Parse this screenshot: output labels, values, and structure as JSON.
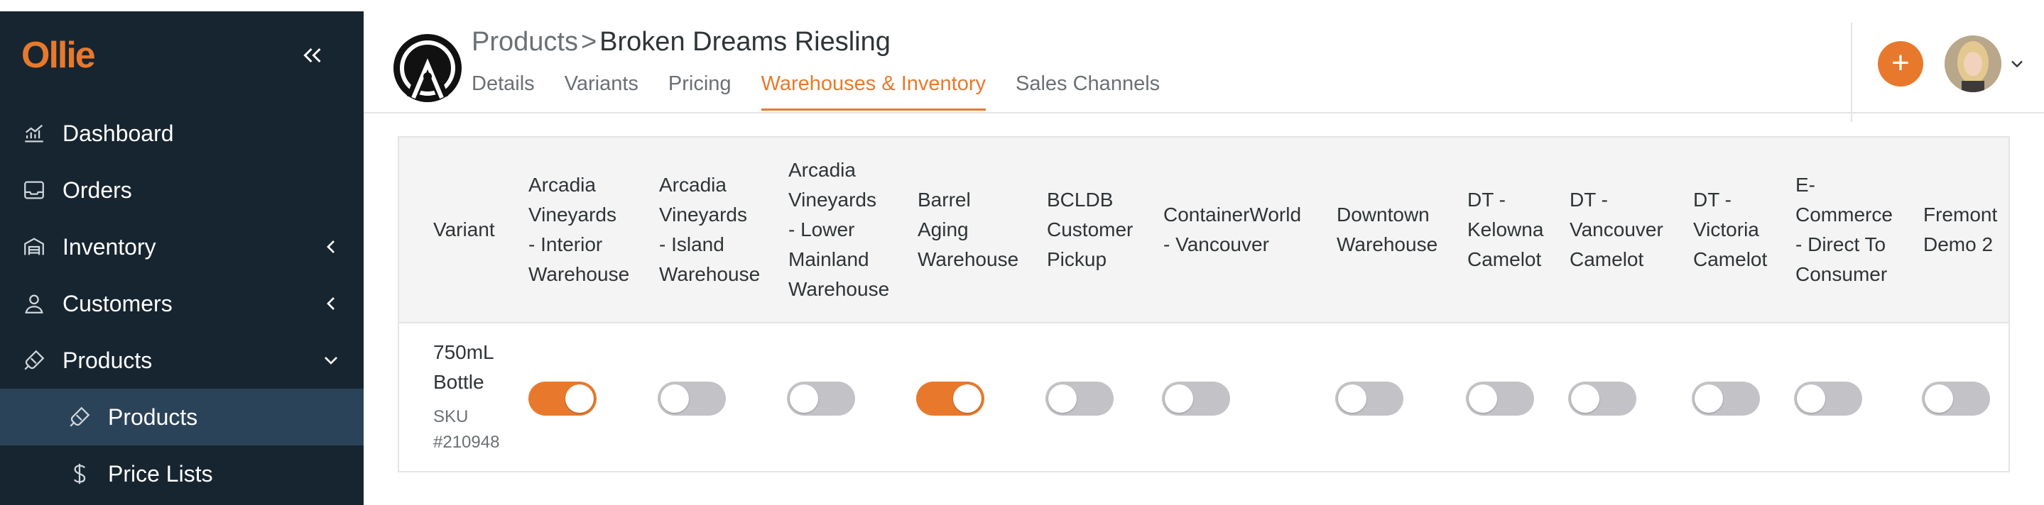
{
  "app": {
    "logo_text": "Ollie"
  },
  "sidebar": {
    "items": [
      {
        "label": "Dashboard",
        "icon": "chart-icon"
      },
      {
        "label": "Orders",
        "icon": "inbox-icon"
      },
      {
        "label": "Inventory",
        "icon": "warehouse-icon",
        "chevron": "left"
      },
      {
        "label": "Customers",
        "icon": "user-icon",
        "chevron": "left"
      },
      {
        "label": "Products",
        "icon": "bottle-icon",
        "chevron": "down"
      }
    ],
    "sub_items": [
      {
        "label": "Products",
        "icon": "bottle-icon",
        "active": true
      },
      {
        "label": "Price Lists",
        "icon": "dollar-icon"
      }
    ]
  },
  "header": {
    "breadcrumb_parent": "Products",
    "breadcrumb_separator": ">",
    "title": "Broken Dreams Riesling",
    "tabs": [
      {
        "label": "Details"
      },
      {
        "label": "Variants"
      },
      {
        "label": "Pricing"
      },
      {
        "label": "Warehouses & Inventory",
        "active": true
      },
      {
        "label": "Sales Channels"
      }
    ],
    "add_button": "+"
  },
  "table": {
    "columns": [
      [
        "Variant"
      ],
      [
        "Arcadia",
        "Vineyards",
        "- Interior",
        "Warehouse"
      ],
      [
        "Arcadia",
        "Vineyards",
        "- Island",
        "Warehouse"
      ],
      [
        "Arcadia",
        "Vineyards",
        "- Lower",
        "Mainland",
        "Warehouse"
      ],
      [
        "Barrel",
        "Aging",
        "Warehouse"
      ],
      [
        "BCLDB",
        "Customer",
        "Pickup"
      ],
      [
        "ContainerWorld",
        "- Vancouver"
      ],
      [
        "Downtown",
        "Warehouse"
      ],
      [
        "DT -",
        "Kelowna",
        "Camelot"
      ],
      [
        "DT -",
        "Vancouver",
        "Camelot"
      ],
      [
        "DT -",
        "Victoria",
        "Camelot"
      ],
      [
        "E-",
        "Commerce",
        "- Direct To",
        "Consumer"
      ],
      [
        "Fremont",
        "Demo 2"
      ]
    ],
    "row": {
      "variant_name_1": "750mL",
      "variant_name_2": "Bottle",
      "sku_1": "SKU",
      "sku_2": "#210948",
      "toggles": [
        true,
        false,
        false,
        true,
        false,
        false,
        false,
        false,
        false,
        false,
        false,
        false
      ]
    }
  },
  "colors": {
    "accent": "#e8792c",
    "sidebar": "#172530",
    "sidebar_active": "#2b4358",
    "toggle_off": "#c3c3c7"
  }
}
